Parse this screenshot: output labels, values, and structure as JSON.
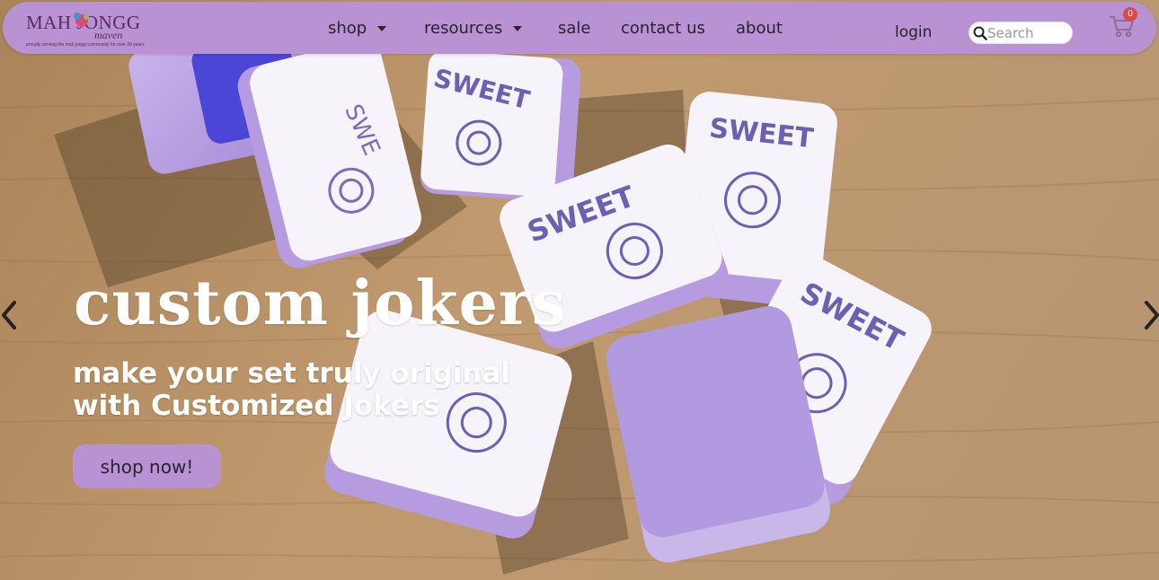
{
  "brand": {
    "logo_line1": "MAH JONGG",
    "logo_line2": "maven",
    "tagline": "proudly serving the mah jongg community for over 20 years"
  },
  "nav": {
    "items": [
      {
        "label": "shop",
        "has_dropdown": true
      },
      {
        "label": "resources",
        "has_dropdown": true
      },
      {
        "label": "sale",
        "has_dropdown": false
      },
      {
        "label": "contact us",
        "has_dropdown": false
      },
      {
        "label": "about",
        "has_dropdown": false
      }
    ],
    "login_label": "login"
  },
  "search": {
    "placeholder": "Search",
    "value": ""
  },
  "cart": {
    "count": "0"
  },
  "hero": {
    "headline": "custom jokers",
    "subline": "make your set truly original with Customized Jokers",
    "cta_label": "shop now!",
    "tile_text": "SWEET"
  },
  "colors": {
    "nav_bg": "#b892d2",
    "tile_purple": "#b39ddb",
    "tile_white": "#f7f5fb",
    "text_dark": "#2b2230",
    "badge": "#d94a4a"
  },
  "icons": [
    "search-icon",
    "cart-icon",
    "chevron-left-icon",
    "chevron-right-icon",
    "caret-down-icon"
  ]
}
